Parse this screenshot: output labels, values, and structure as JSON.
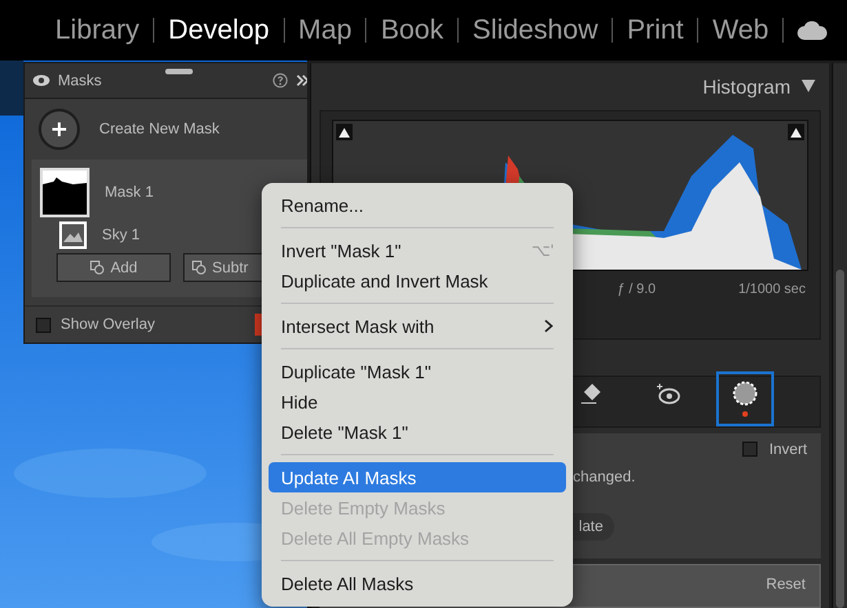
{
  "modules": [
    {
      "label": "Library",
      "selected": false
    },
    {
      "label": "Develop",
      "selected": true
    },
    {
      "label": "Map",
      "selected": false
    },
    {
      "label": "Book",
      "selected": false
    },
    {
      "label": "Slideshow",
      "selected": false
    },
    {
      "label": "Print",
      "selected": false
    },
    {
      "label": "Web",
      "selected": false
    }
  ],
  "masks_panel": {
    "title": "Masks",
    "create_label": "Create New Mask",
    "masks": [
      {
        "name": "Mask 1",
        "components": [
          {
            "name": "Sky 1"
          }
        ]
      }
    ],
    "add_button": "Add",
    "subtract_button": "Subtr",
    "show_overlay": {
      "label": "Show Overlay",
      "checked": false
    }
  },
  "histogram": {
    "title": "Histogram",
    "aperture": "ƒ / 9.0",
    "shutter": "1/1000 sec"
  },
  "tools": [
    {
      "kind": "eraser",
      "selected": false
    },
    {
      "kind": "eye",
      "selected": false
    },
    {
      "kind": "sky",
      "selected": true
    }
  ],
  "mask_settings": {
    "invert": {
      "label": "Invert",
      "checked": false
    },
    "message": "changed.",
    "update_button": "late",
    "reset": "Reset"
  },
  "context_menu": [
    {
      "kind": "item",
      "label": "Rename...",
      "disabled": false,
      "selected": false
    },
    {
      "kind": "separator"
    },
    {
      "kind": "item",
      "label": "Invert \"Mask 1\"",
      "shortcut": "⌥'",
      "disabled": false,
      "selected": false
    },
    {
      "kind": "item",
      "label": "Duplicate and Invert Mask",
      "disabled": false,
      "selected": false
    },
    {
      "kind": "separator"
    },
    {
      "kind": "item",
      "label": "Intersect Mask with",
      "submenu": true,
      "disabled": false,
      "selected": false
    },
    {
      "kind": "separator"
    },
    {
      "kind": "item",
      "label": "Duplicate \"Mask 1\"",
      "disabled": false,
      "selected": false
    },
    {
      "kind": "item",
      "label": "Hide",
      "disabled": false,
      "selected": false
    },
    {
      "kind": "item",
      "label": "Delete \"Mask 1\"",
      "disabled": false,
      "selected": false
    },
    {
      "kind": "separator"
    },
    {
      "kind": "item",
      "label": "Update AI Masks",
      "disabled": false,
      "selected": true
    },
    {
      "kind": "item",
      "label": "Delete Empty Masks",
      "disabled": true,
      "selected": false
    },
    {
      "kind": "item",
      "label": "Delete All Empty Masks",
      "disabled": true,
      "selected": false
    },
    {
      "kind": "separator"
    },
    {
      "kind": "item",
      "label": "Delete All Masks",
      "disabled": false,
      "selected": false
    }
  ]
}
